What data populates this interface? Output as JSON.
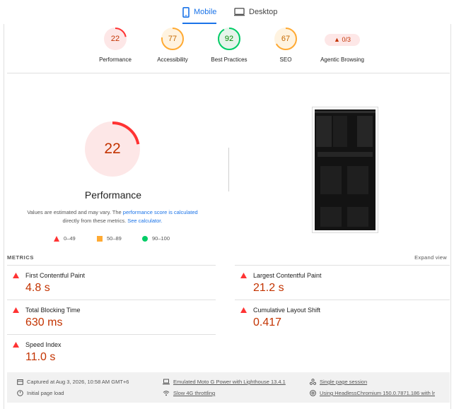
{
  "tabs": {
    "mobile": "Mobile",
    "desktop": "Desktop"
  },
  "gauges": [
    {
      "label": "Performance",
      "score": "22",
      "color": "#c33300",
      "fill": 0.22
    },
    {
      "label": "Accessibility",
      "score": "77",
      "color": "#c66900",
      "fill": 0.77
    },
    {
      "label": "Best Practices",
      "score": "92",
      "color": "#008800",
      "fill": 0.92
    },
    {
      "label": "SEO",
      "score": "67",
      "color": "#c66900",
      "fill": 0.67
    },
    {
      "label": "Agentic Browsing",
      "score": "0/3",
      "color": "#c33300"
    }
  ],
  "performance": {
    "score": "22",
    "title": "Performance",
    "note_prefix": "Values are estimated and may vary. The ",
    "note_link1": "performance score is calculated",
    "note_mid": " directly from these metrics. ",
    "note_link2": "See calculator.",
    "legend": [
      {
        "range": "0–49",
        "color": "#ff3333"
      },
      {
        "range": "50–89",
        "color": "#ffaa33"
      },
      {
        "range": "90–100",
        "color": "#00cc66"
      }
    ]
  },
  "metrics": {
    "heading": "METRICS",
    "expand": "Expand view",
    "items": [
      {
        "name": "First Contentful Paint",
        "value": "4.8 s"
      },
      {
        "name": "Largest Contentful Paint",
        "value": "21.2 s"
      },
      {
        "name": "Total Blocking Time",
        "value": "630 ms"
      },
      {
        "name": "Cumulative Layout Shift",
        "value": "0.417"
      },
      {
        "name": "Speed Index",
        "value": "11.0 s"
      }
    ]
  },
  "footer": {
    "captured": "Captured at Aug 3, 2026, 10:58 AM GMT+6",
    "initial": "Initial page load",
    "emulated": "Emulated Moto G Power with Lighthouse 13.4.1",
    "throttling": "Slow 4G throttling",
    "session": "Single page session",
    "browser": "Using HeadlessChromium 150.0.7871.186 with lr"
  },
  "colors": {
    "fail": "#c33300",
    "average": "#c66900",
    "pass": "#008800",
    "accent": "#1a73e8"
  }
}
